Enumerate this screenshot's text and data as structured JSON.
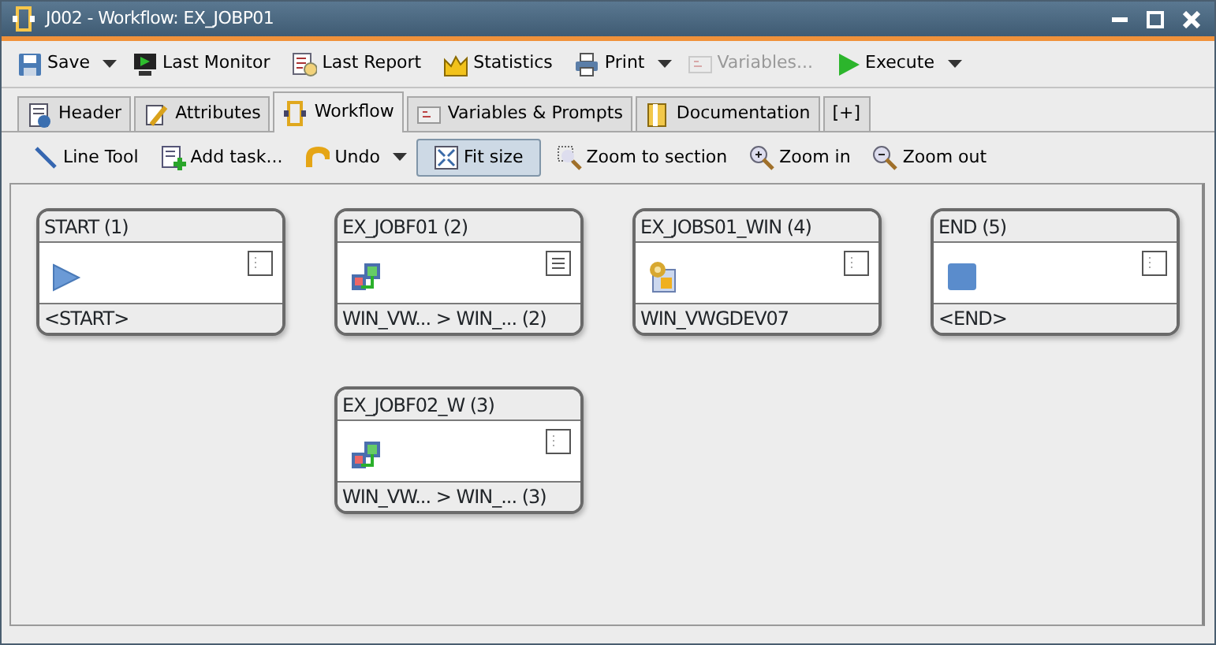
{
  "window": {
    "title": "J002 - Workflow: EX_JOBP01"
  },
  "toolbar": [
    {
      "label": "Save",
      "dropdown": true,
      "disabled": false
    },
    {
      "label": "Last Monitor",
      "dropdown": false,
      "disabled": false
    },
    {
      "label": "Last Report",
      "dropdown": false,
      "disabled": false
    },
    {
      "label": "Statistics",
      "dropdown": false,
      "disabled": false
    },
    {
      "label": "Print",
      "dropdown": true,
      "disabled": false
    },
    {
      "label": "Variables...",
      "dropdown": false,
      "disabled": true
    },
    {
      "label": "Execute",
      "dropdown": true,
      "disabled": false
    }
  ],
  "tabs": [
    {
      "label": "Header",
      "selected": false
    },
    {
      "label": "Attributes",
      "selected": false
    },
    {
      "label": "Workflow",
      "selected": true
    },
    {
      "label": "Variables & Prompts",
      "selected": false
    },
    {
      "label": "Documentation",
      "selected": false
    },
    {
      "label": "[+]",
      "selected": false
    }
  ],
  "workflow_toolbar": [
    {
      "label": "Line Tool",
      "dropdown": false,
      "pressed": false
    },
    {
      "label": "Add task...",
      "dropdown": false,
      "pressed": false
    },
    {
      "label": "Undo",
      "dropdown": true,
      "pressed": false
    },
    {
      "label": "Fit size",
      "dropdown": false,
      "pressed": true
    },
    {
      "label": "Zoom to section",
      "dropdown": false,
      "pressed": false
    },
    {
      "label": "Zoom in",
      "dropdown": false,
      "pressed": false
    },
    {
      "label": "Zoom out",
      "dropdown": false,
      "pressed": false
    }
  ],
  "nodes": [
    {
      "title": "START (1)",
      "kind": "start",
      "has_notes": false,
      "footer": "<START>"
    },
    {
      "title": "EX_JOBF01 (2)",
      "kind": "transfer",
      "has_notes": true,
      "footer": "WIN_VW... > WIN_... (2)"
    },
    {
      "title": "EX_JOBS01_WIN (4)",
      "kind": "job",
      "has_notes": false,
      "footer": "WIN_VWGDEV07"
    },
    {
      "title": "END (5)",
      "kind": "end",
      "has_notes": false,
      "footer": "<END>"
    },
    {
      "title": "EX_JOBF02_W (3)",
      "kind": "transfer",
      "has_notes": false,
      "footer": "WIN_VW... > WIN_... (3)"
    }
  ]
}
